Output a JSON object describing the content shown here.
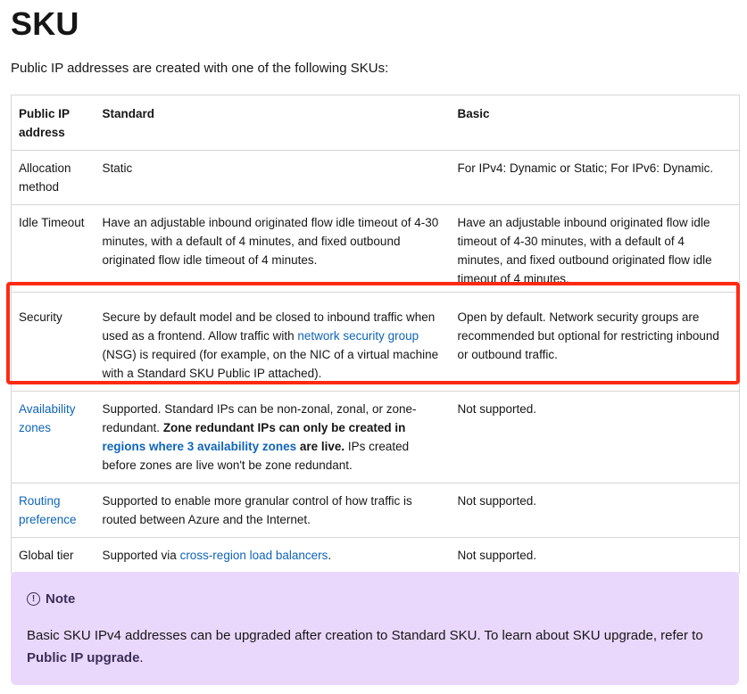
{
  "title": "SKU",
  "intro": "Public IP addresses are created with one of the following SKUs:",
  "table": {
    "headers": [
      "Public IP address",
      "Standard",
      "Basic"
    ],
    "rows": [
      {
        "label": "Allocation method",
        "standard": "Static",
        "basic": "For IPv4: Dynamic or Static; For IPv6: Dynamic."
      },
      {
        "label": "Idle Timeout",
        "standard": "Have an adjustable inbound originated flow idle timeout of 4-30 minutes, with a default of 4 minutes, and fixed outbound originated flow idle timeout of 4 minutes.",
        "basic": "Have an adjustable inbound originated flow idle timeout of 4-30 minutes, with a default of 4 minutes, and fixed outbound originated flow idle timeout of 4 minutes."
      },
      {
        "label": "Security",
        "standard_pre": "Secure by default model and be closed to inbound traffic when used as a frontend. Allow traffic with ",
        "standard_link": "network security group",
        "standard_post": " (NSG) is required (for example, on the NIC of a virtual machine with a Standard SKU Public IP attached).",
        "basic": "Open by default. Network security groups are recommended but optional for restricting inbound or outbound traffic."
      },
      {
        "label_link": "Availability zones",
        "standard_pre": "Supported. Standard IPs can be non-zonal, zonal, or zone-redundant. ",
        "standard_bold": "Zone redundant IPs can only be created in ",
        "standard_bold_link": "regions where 3 availability zones",
        "standard_bold_post": " are live.",
        "standard_post": " IPs created before zones are live won't be zone redundant.",
        "basic": "Not supported."
      },
      {
        "label_link": "Routing preference",
        "standard": "Supported to enable more granular control of how traffic is routed between Azure and the Internet.",
        "basic": "Not supported."
      },
      {
        "label": "Global tier",
        "standard_pre": "Supported via ",
        "standard_link": "cross-region load balancers",
        "standard_post": ".",
        "basic": "Not supported."
      }
    ]
  },
  "note": {
    "icon": "info-icon",
    "glyph": "!",
    "title": "Note",
    "body": "Basic SKU IPv4 addresses can be upgraded after creation to Standard SKU. To learn about SKU upgrade, refer to ",
    "link": "Public IP upgrade",
    "body_end": "."
  },
  "colors": {
    "link": "#0f64b8",
    "highlight_border": "#ff2a12",
    "note_background": "#ead7fc"
  }
}
